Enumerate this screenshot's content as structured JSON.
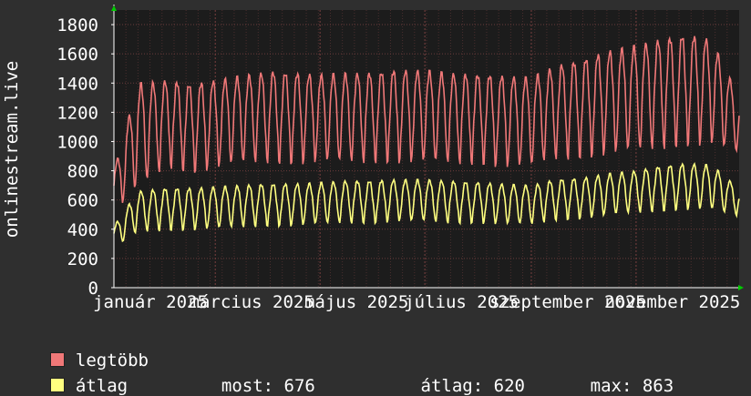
{
  "chart_data": {
    "type": "line",
    "ylabel": "onlinestream.live",
    "ylim": [
      0,
      1900
    ],
    "yticks": [
      0,
      200,
      400,
      600,
      800,
      1000,
      1200,
      1400,
      1600,
      1800
    ],
    "xlim": [
      "2025-01-01",
      "2025-12-31"
    ],
    "xticks": [
      {
        "date": "2025-01-01",
        "label": "január 2025"
      },
      {
        "date": "2025-03-01",
        "label": "március 2025"
      },
      {
        "date": "2025-05-01",
        "label": "május 2025"
      },
      {
        "date": "2025-07-01",
        "label": "július 2025"
      },
      {
        "date": "2025-09-01",
        "label": "szeptember 2025"
      },
      {
        "date": "2025-11-01",
        "label": "november 2025"
      }
    ],
    "grid": true,
    "x": [
      "2025-01-01",
      "2025-01-15",
      "2025-02-01",
      "2025-02-15",
      "2025-03-01",
      "2025-03-15",
      "2025-04-01",
      "2025-04-15",
      "2025-05-01",
      "2025-05-15",
      "2025-06-01",
      "2025-06-15",
      "2025-07-01",
      "2025-07-15",
      "2025-08-01",
      "2025-08-15",
      "2025-09-01",
      "2025-09-15",
      "2025-10-01",
      "2025-10-15",
      "2025-11-01",
      "2025-11-15",
      "2025-12-01",
      "2025-12-15",
      "2025-12-31"
    ],
    "series": [
      {
        "name": "legtöbb",
        "color": "#f07878",
        "high": [
          800,
          1400,
          1420,
          1390,
          1420,
          1450,
          1480,
          1470,
          1460,
          1470,
          1470,
          1490,
          1490,
          1470,
          1460,
          1450,
          1440,
          1520,
          1560,
          1620,
          1660,
          1700,
          1730,
          1700,
          1300
        ],
        "low": [
          500,
          650,
          800,
          760,
          790,
          820,
          830,
          820,
          830,
          830,
          830,
          830,
          830,
          820,
          820,
          800,
          800,
          850,
          860,
          880,
          900,
          920,
          940,
          950,
          900
        ]
      },
      {
        "name": "átlag",
        "color": "#ffff80",
        "high": [
          420,
          660,
          680,
          680,
          690,
          700,
          710,
          710,
          720,
          730,
          730,
          740,
          740,
          730,
          720,
          710,
          700,
          740,
          750,
          780,
          800,
          830,
          850,
          840,
          676
        ],
        "low": [
          260,
          370,
          380,
          380,
          390,
          400,
          410,
          410,
          420,
          430,
          430,
          440,
          440,
          430,
          430,
          420,
          420,
          450,
          460,
          480,
          500,
          510,
          520,
          520,
          480
        ]
      }
    ],
    "legend": {
      "entries": [
        {
          "label": "legtöbb",
          "color": "#f07878"
        },
        {
          "label": "átlag",
          "color": "#ffff80",
          "stats": [
            {
              "label": "most:",
              "value": "676"
            },
            {
              "label": "átlag:",
              "value": "620"
            },
            {
              "label": "max:",
              "value": "863"
            }
          ]
        }
      ],
      "placement": "bottom-left"
    }
  }
}
